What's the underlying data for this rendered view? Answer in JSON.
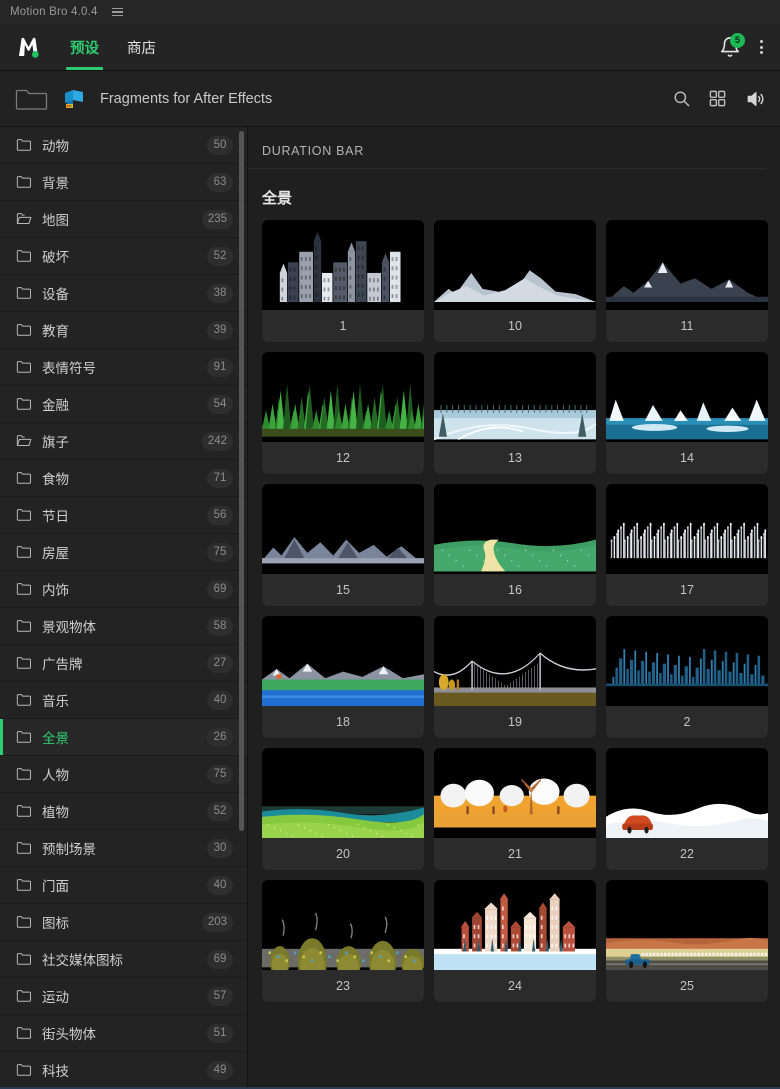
{
  "window": {
    "app_title": "Motion Bro 4.0.4",
    "menu_icon": "hamburger-icon"
  },
  "topnav": {
    "logo": "motion-bro-logo",
    "tabs": [
      {
        "label": "预设",
        "active": true
      },
      {
        "label": "商店",
        "active": false
      }
    ],
    "notification_badge": "5",
    "bell_icon": "bell-icon",
    "more_icon": "kebab-menu-icon",
    "accent_color": "#2ecc71"
  },
  "toolbar": {
    "folder_icon": "folder-icon",
    "package_icon": "package-icon",
    "title": "Fragments for After Effects",
    "search_icon": "search-icon",
    "grid_icon": "grid-view-icon",
    "sound_icon": "speaker-icon"
  },
  "sidebar": {
    "items": [
      {
        "label": "动物",
        "count": "50",
        "selected": false
      },
      {
        "label": "背景",
        "count": "63",
        "selected": false
      },
      {
        "label": "地图",
        "count": "235",
        "selected": false
      },
      {
        "label": "破坏",
        "count": "52",
        "selected": false
      },
      {
        "label": "设备",
        "count": "38",
        "selected": false
      },
      {
        "label": "教育",
        "count": "39",
        "selected": false
      },
      {
        "label": "表情符号",
        "count": "91",
        "selected": false
      },
      {
        "label": "金融",
        "count": "54",
        "selected": false
      },
      {
        "label": "旗子",
        "count": "242",
        "selected": false
      },
      {
        "label": "食物",
        "count": "71",
        "selected": false
      },
      {
        "label": "节日",
        "count": "56",
        "selected": false
      },
      {
        "label": "房屋",
        "count": "75",
        "selected": false
      },
      {
        "label": "内饰",
        "count": "69",
        "selected": false
      },
      {
        "label": "景观物体",
        "count": "58",
        "selected": false
      },
      {
        "label": "广告牌",
        "count": "27",
        "selected": false
      },
      {
        "label": "音乐",
        "count": "40",
        "selected": false
      },
      {
        "label": "全景",
        "count": "26",
        "selected": true
      },
      {
        "label": "人物",
        "count": "75",
        "selected": false
      },
      {
        "label": "植物",
        "count": "52",
        "selected": false
      },
      {
        "label": "预制场景",
        "count": "30",
        "selected": false
      },
      {
        "label": "门面",
        "count": "40",
        "selected": false
      },
      {
        "label": "图标",
        "count": "203",
        "selected": false
      },
      {
        "label": "社交媒体图标",
        "count": "69",
        "selected": false
      },
      {
        "label": "运动",
        "count": "57",
        "selected": false
      },
      {
        "label": "街头物体",
        "count": "51",
        "selected": false
      },
      {
        "label": "科技",
        "count": "49",
        "selected": false
      }
    ]
  },
  "main": {
    "duration_bar_label": "DURATION BAR",
    "section_title": "全景",
    "items": [
      {
        "label": "1",
        "art": "townhouses"
      },
      {
        "label": "10",
        "art": "snow-peaks"
      },
      {
        "label": "11",
        "art": "dark-mountains"
      },
      {
        "label": "12",
        "art": "forest"
      },
      {
        "label": "13",
        "art": "snow-field"
      },
      {
        "label": "14",
        "art": "icebergs"
      },
      {
        "label": "15",
        "art": "rocky-range"
      },
      {
        "label": "16",
        "art": "green-path"
      },
      {
        "label": "17",
        "art": "crowd"
      },
      {
        "label": "18",
        "art": "lake-hills"
      },
      {
        "label": "19",
        "art": "suspension-bridge"
      },
      {
        "label": "2",
        "art": "city-skyline"
      },
      {
        "label": "20",
        "art": "meadow-lake"
      },
      {
        "label": "21",
        "art": "savanna"
      },
      {
        "label": "22",
        "art": "car-snow"
      },
      {
        "label": "23",
        "art": "garbage-dump"
      },
      {
        "label": "24",
        "art": "snow-town"
      },
      {
        "label": "25",
        "art": "desert-truck"
      }
    ]
  }
}
